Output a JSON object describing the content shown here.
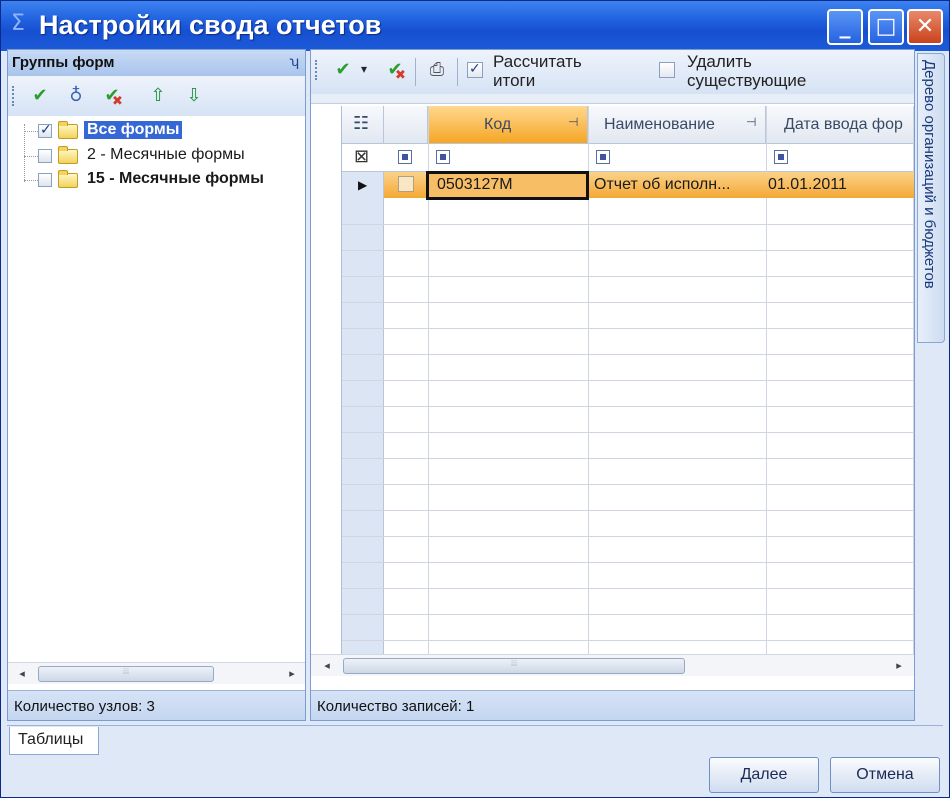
{
  "window": {
    "title": "Настройки свода отчетов",
    "title_icon": "sigma-icon",
    "controls": {
      "minimize": "_",
      "maximize": "□",
      "close": "✕"
    }
  },
  "left_panel": {
    "header": "Группы форм",
    "pin": "ʮ",
    "toolbar": [
      "check-icon",
      "stethoscope-icon",
      "check-cancel-icon",
      "export-icon",
      "import-icon"
    ],
    "tree": [
      {
        "label": "Все формы",
        "checked": true,
        "selected": true
      },
      {
        "label": "2 - Месячные формы",
        "checked": false,
        "selected": false
      },
      {
        "label": "15 - Месячные формы",
        "checked": false,
        "selected": false
      }
    ],
    "scroll": {
      "left": "◂",
      "right": "▸"
    },
    "status": "Количество узлов: 3"
  },
  "right_panel": {
    "toolbar": {
      "dropdown_arrow": "▾",
      "option_totals": {
        "label": "Рассчитать\nитоги",
        "checked": true
      },
      "option_delete": {
        "label": "Удалить\nсуществующие",
        "checked": false
      }
    },
    "grid": {
      "columns": [
        {
          "label": "Код",
          "pinned": true,
          "active": true
        },
        {
          "label": "Наименование",
          "pinned": true,
          "active": false
        },
        {
          "label": "Дата ввода фор",
          "pinned": false,
          "active": false
        }
      ],
      "rows": [
        {
          "code": "0503127М",
          "name": "Отчет об исполн...",
          "date": "01.01.2011"
        }
      ]
    },
    "scroll": {
      "left": "◂",
      "right": "▸"
    },
    "status": "Количество записей: 1"
  },
  "side_tab": "Дерево организаций и бюджетов",
  "bottom": {
    "tab": "Таблицы",
    "next_button": "Далее",
    "cancel_button": "Отмена"
  },
  "colors": {
    "title_bar": "#1f5fde",
    "selection": "#3568d4",
    "active_row": "#f4a834"
  }
}
